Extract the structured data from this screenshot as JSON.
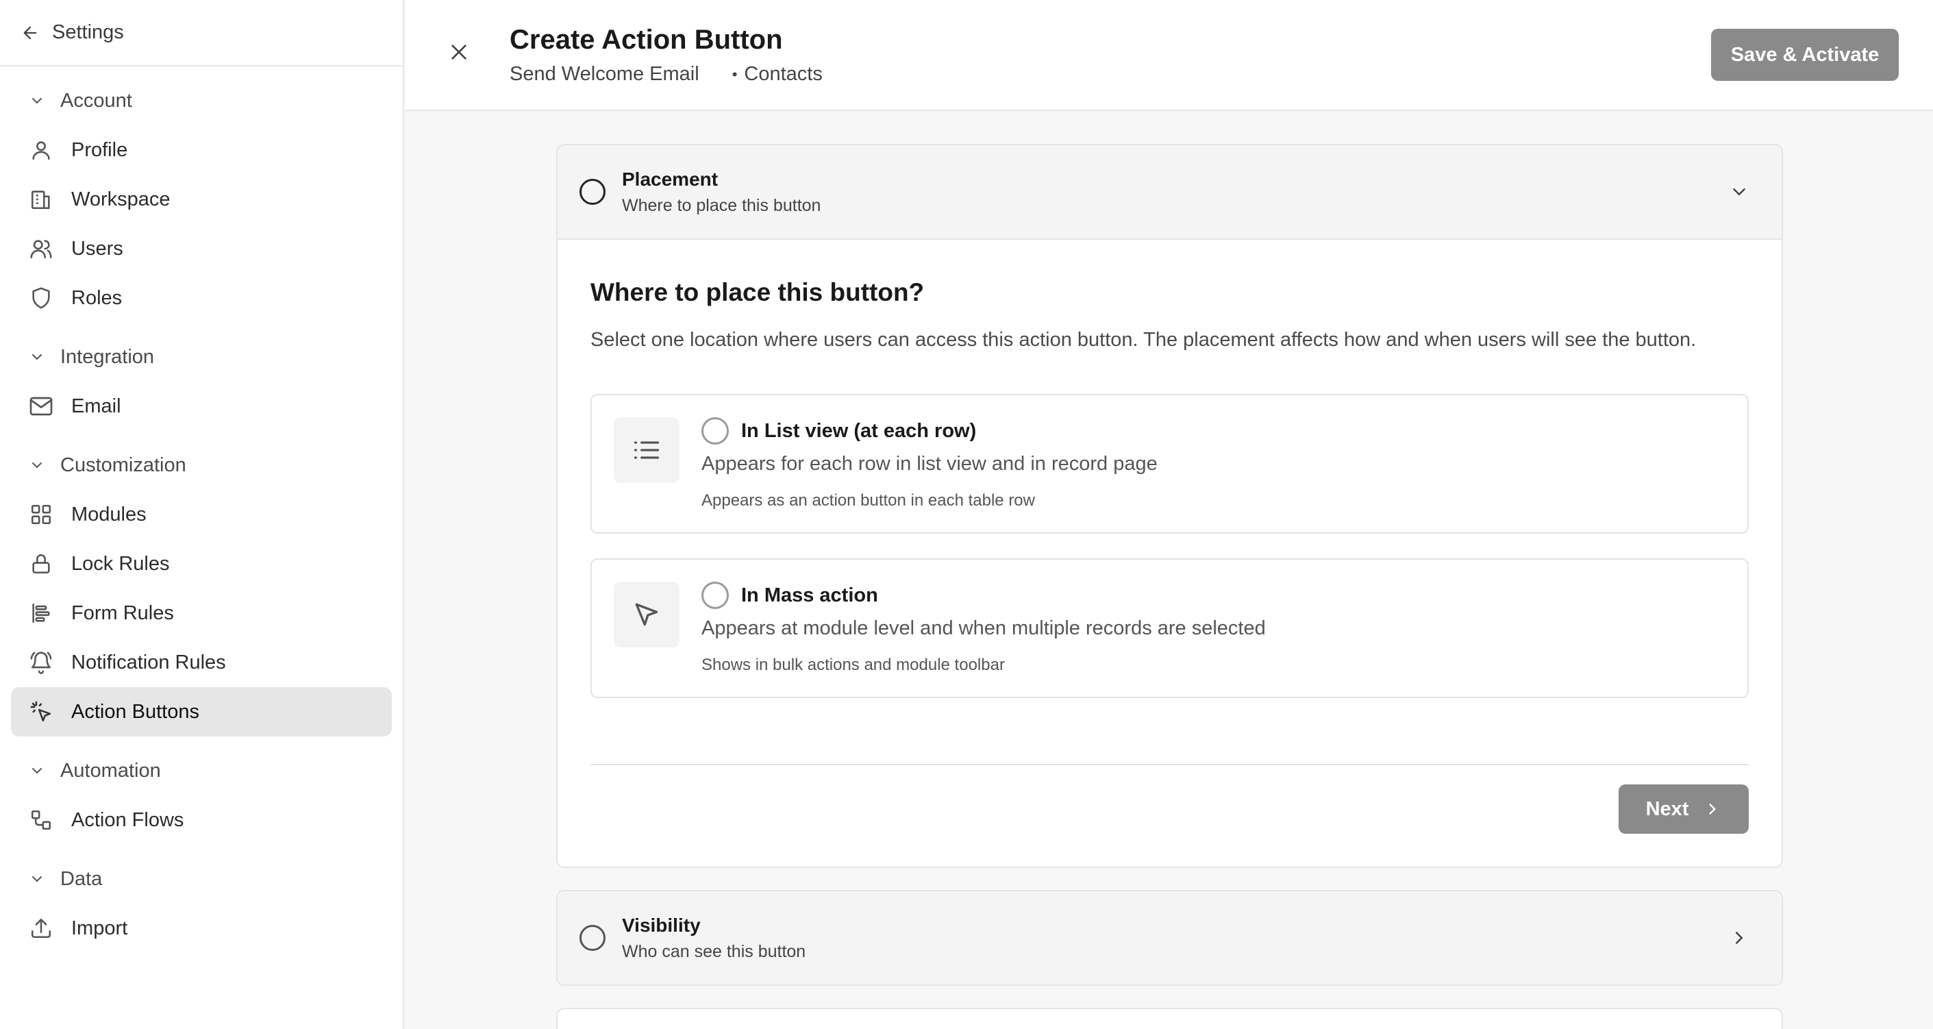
{
  "sidebar": {
    "back_label": "Settings",
    "groups": [
      {
        "label": "Account",
        "items": [
          {
            "label": "Profile",
            "icon": "user-icon"
          },
          {
            "label": "Workspace",
            "icon": "building-icon"
          },
          {
            "label": "Users",
            "icon": "users-icon"
          },
          {
            "label": "Roles",
            "icon": "shield-icon"
          }
        ]
      },
      {
        "label": "Integration",
        "items": [
          {
            "label": "Email",
            "icon": "mail-icon"
          }
        ]
      },
      {
        "label": "Customization",
        "items": [
          {
            "label": "Modules",
            "icon": "grid-icon"
          },
          {
            "label": "Lock Rules",
            "icon": "lock-icon"
          },
          {
            "label": "Form Rules",
            "icon": "align-left-icon"
          },
          {
            "label": "Notification Rules",
            "icon": "bell-icon"
          },
          {
            "label": "Action Buttons",
            "icon": "pointer-click-icon",
            "active": true
          }
        ]
      },
      {
        "label": "Automation",
        "items": [
          {
            "label": "Action Flows",
            "icon": "workflow-icon"
          }
        ]
      },
      {
        "label": "Data",
        "items": [
          {
            "label": "Import",
            "icon": "upload-icon"
          }
        ]
      }
    ]
  },
  "header": {
    "title": "Create Action Button",
    "subtitle_name": "Send Welcome Email",
    "subtitle_module": "Contacts",
    "save_label": "Save & Activate"
  },
  "placement": {
    "title": "Placement",
    "subtitle": "Where to place this button",
    "question": "Where to place this button?",
    "description": "Select one location where users can access this action button. The placement affects how and when users will see the button.",
    "options": [
      {
        "title": "In List view (at each row)",
        "desc": "Appears for each row in list view and in record page",
        "note": "Appears as an action button in each table row",
        "icon": "list-icon"
      },
      {
        "title": "In Mass action",
        "desc": "Appears at module level and when multiple records are selected",
        "note": "Shows in bulk actions and module toolbar",
        "icon": "cursor-arrow-icon"
      }
    ],
    "next_label": "Next"
  },
  "visibility": {
    "title": "Visibility",
    "subtitle": "Who can see this button"
  }
}
